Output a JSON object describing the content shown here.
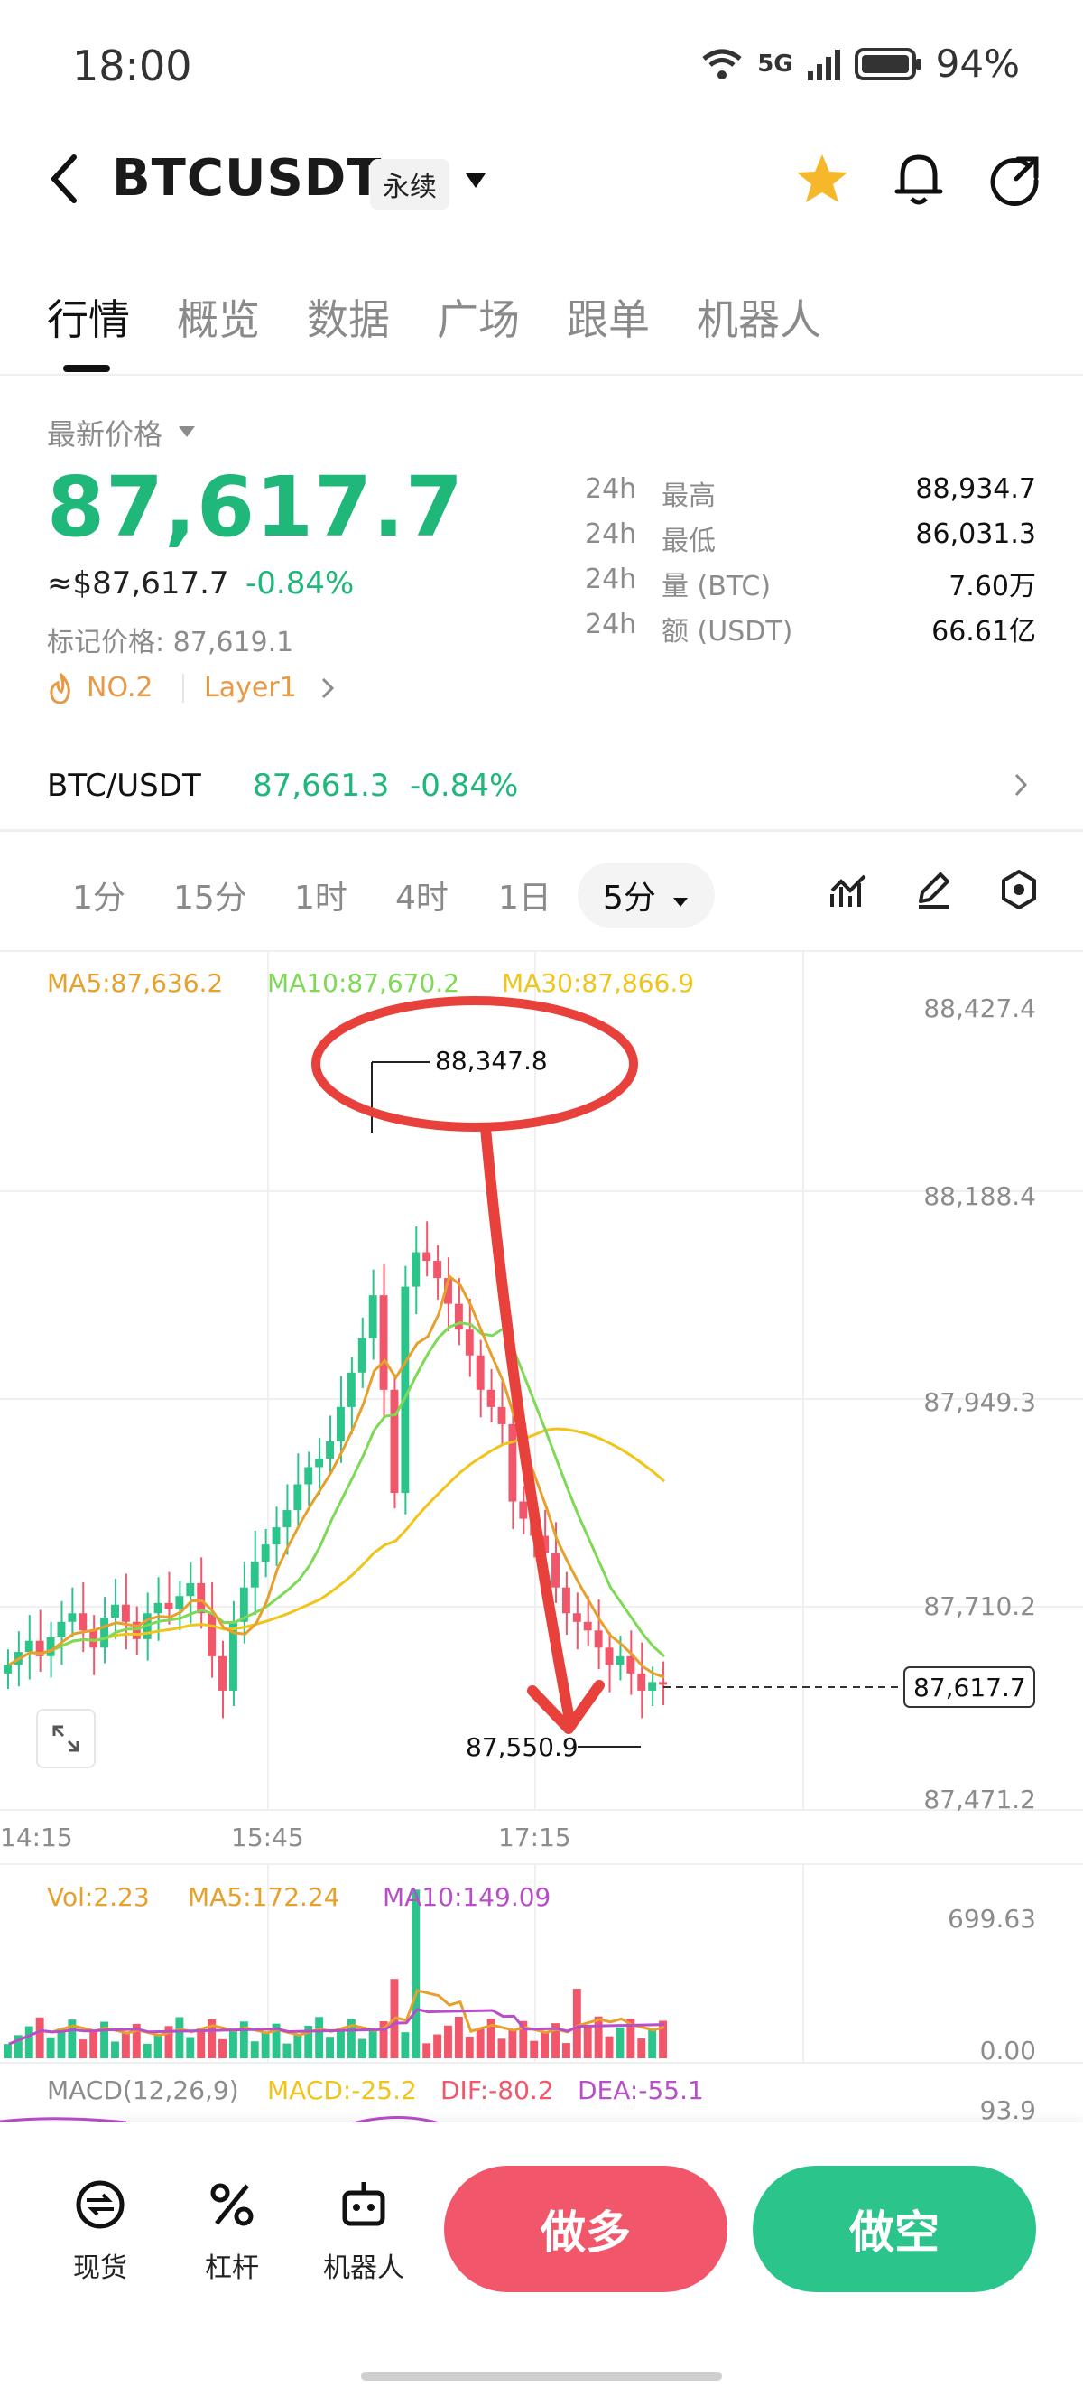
{
  "status_bar": {
    "time": "18:00",
    "network": "5G",
    "battery": "94%"
  },
  "header": {
    "symbol": "BTCUSDT",
    "contract_type": "永续"
  },
  "tabs": [
    {
      "label": "行情",
      "active": true
    },
    {
      "label": "概览"
    },
    {
      "label": "数据"
    },
    {
      "label": "广场"
    },
    {
      "label": "跟单"
    },
    {
      "label": "机器人"
    }
  ],
  "price": {
    "title": "最新价格",
    "last": "87,617.7",
    "usd": "≈$87,617.7",
    "change": "-0.84%",
    "mark_label": "标记价格: 87,619.1",
    "rank": "NO.2",
    "category": "Layer1"
  },
  "stats": [
    {
      "period": "24h",
      "label": "最高",
      "value": "88,934.7"
    },
    {
      "period": "24h",
      "label": "最低",
      "value": "86,031.3"
    },
    {
      "period": "24h",
      "label": "量 (BTC)",
      "value": "7.60万"
    },
    {
      "period": "24h",
      "label": "额 (USDT)",
      "value": "66.61亿"
    }
  ],
  "spot": {
    "pair": "BTC/USDT",
    "price": "87,661.3",
    "change": "-0.84%"
  },
  "intervals": [
    "1分",
    "15分",
    "1时",
    "4时",
    "1日"
  ],
  "interval_selected": "5分",
  "chart_labels": {
    "ma5": "MA5:87,636.2",
    "ma10": "MA10:87,670.2",
    "ma30": "MA30:87,866.9",
    "y_ticks": [
      "88,427.4",
      "88,188.4",
      "87,949.3",
      "87,710.2",
      "87,471.2"
    ],
    "x_ticks": [
      "14:15",
      "15:45",
      "17:15"
    ],
    "high_marker": "88,347.8",
    "low_marker": "87,550.9",
    "current_price": "87,617.7",
    "vol_label": "Vol:2.23",
    "vol_ma5": "MA5:172.24",
    "vol_ma10": "MA10:149.09",
    "vol_ticks": [
      "699.63",
      "0.00"
    ],
    "macd_name": "MACD(12,26,9)",
    "macd": "MACD:-25.2",
    "dif": "DIF:-80.2",
    "dea": "DEA:-55.1",
    "macd_tick": "93.9"
  },
  "chart_data": {
    "type": "candlestick",
    "interval": "5分",
    "y_range": [
      87471.2,
      88427.4
    ],
    "price_high": 88347.8,
    "price_low": 87550.9,
    "last_price": 87617.7,
    "ma_colors": {
      "ma5": "#e8a02c",
      "ma10": "#7ed957",
      "ma30": "#f0c419"
    },
    "up_color": "#2bc48a",
    "down_color": "#f2566a"
  },
  "bottom_nav": {
    "spot": "现货",
    "leverage": "杠杆",
    "bots": "机器人",
    "long": "做多",
    "short": "做空"
  },
  "colors": {
    "green": "#1fb77a",
    "red": "#f2566a",
    "orange": "#e79a43",
    "star": "#f6b82a"
  }
}
